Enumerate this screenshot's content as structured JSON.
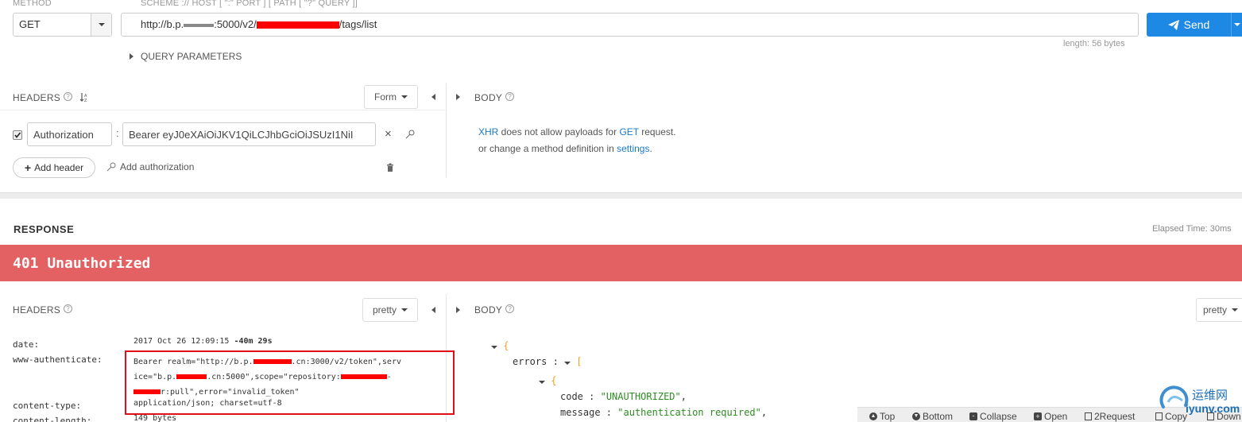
{
  "request": {
    "method_label": "METHOD",
    "method_value": "GET",
    "url_label": "SCHEME :// HOST [ \":\" PORT ] [ PATH [ \"?\" QUERY ]]",
    "url_part1": "http://b.p.",
    "url_part2": ":5000/v2/",
    "url_part3": "/tags/list",
    "send_label": "Send",
    "length_text": "length: 56 bytes",
    "query_params_label": "QUERY PARAMETERS"
  },
  "req_headers": {
    "title": "HEADERS",
    "form_label": "Form",
    "header_name": "Authorization",
    "header_value": "Bearer eyJ0eXAiOiJKV1QiLCJhbGciOiJSUzI1NiI",
    "add_header_label": "Add header",
    "add_auth_label": "Add authorization"
  },
  "req_body": {
    "title": "BODY",
    "msg_xhr": "XHR",
    "msg_mid": " does not allow payloads for ",
    "msg_method": "GET",
    "msg_end": " request.",
    "msg2_start": "or change a method definition in ",
    "msg2_link": "settings",
    "msg2_end": "."
  },
  "response": {
    "title": "RESPONSE",
    "elapsed": "Elapsed Time: 30ms",
    "status": "401 Unauthorized",
    "status_color": "#e46163",
    "headers_title": "HEADERS",
    "pretty_label": "pretty",
    "body_title": "BODY",
    "headers": [
      {
        "name": "date:",
        "value": "2017 Oct 26 12:09:15 ",
        "extra": "-40m 29s"
      },
      {
        "name": "www-authenticate:",
        "line1a": "Bearer realm=\"http://b.p.",
        "line1b": ".cn:3000/v2/token\",serv",
        "line2a": "ice=\"b.p.",
        "line2b": ".cn:5000\",scope=\"repository:",
        "line2c": "-",
        "line3": "r:pull\",error=\"invalid_token\""
      },
      {
        "name": "content-type:",
        "value": "application/json; charset=utf-8"
      },
      {
        "name": "content-length:",
        "value": "149 bytes"
      }
    ],
    "body": {
      "errors_key": "errors",
      "code_key": "code",
      "code_val": "\"UNAUTHORIZED\"",
      "message_key": "message",
      "message_val": "\"authentication required\""
    }
  },
  "footer_toolbar": {
    "top": "Top",
    "bottom": "Bottom",
    "collapse": "Collapse",
    "open": "Open",
    "to_request": "2Request",
    "copy": "Copy",
    "download": "Down"
  },
  "watermark": {
    "brand": "运维网",
    "site": "iyunv.com"
  }
}
